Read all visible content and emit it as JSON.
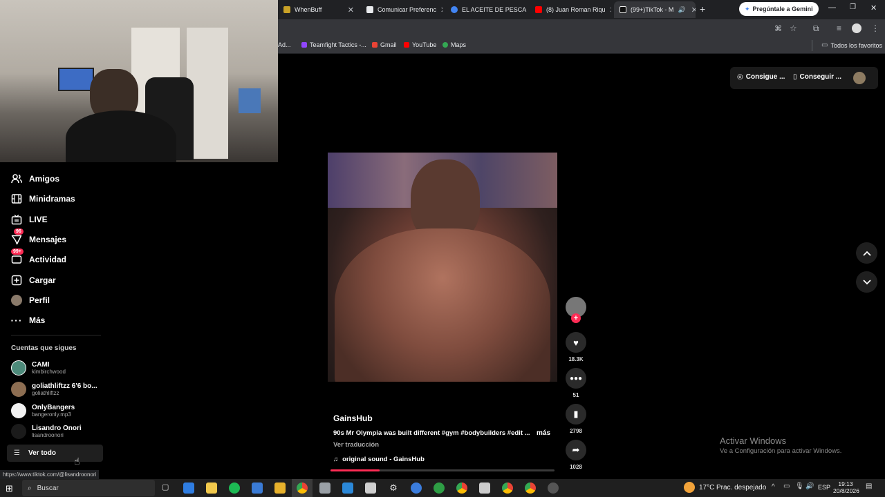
{
  "browser": {
    "tabs": [
      {
        "label": "WhenBuff",
        "favicon_color": "#c9a227"
      },
      {
        "label": "Comunicar Preferenc",
        "favicon_color": "#e8eaed"
      },
      {
        "label": "EL ACEITE DE PESCAI",
        "favicon_color": "#4285f4"
      },
      {
        "label": "(8) Juan Roman Riqu",
        "favicon_color": "#ff0000"
      },
      {
        "label": "(99+)TikTok - M",
        "favicon_color": "#000000"
      }
    ],
    "gemini_button": "Pregúntale a Gemini",
    "bookmarks": [
      {
        "label": "Ad...",
        "color": "#777777"
      },
      {
        "label": "Teamfight Tactics -...",
        "color": "#9146ff"
      },
      {
        "label": "Gmail",
        "color": "#ea4335"
      },
      {
        "label": "YouTube",
        "color": "#ff0000"
      },
      {
        "label": "Maps",
        "color": "#34a853"
      }
    ],
    "all_bookmarks": "Todos los favoritos"
  },
  "header": {
    "coins_button": "Consigue ...",
    "app_button": "Conseguir ..."
  },
  "sidebar": {
    "items": [
      {
        "label": "Amigos",
        "icon": "friends-icon"
      },
      {
        "label": "Minidramas",
        "icon": "film-icon"
      },
      {
        "label": "LIVE",
        "icon": "live-icon"
      },
      {
        "label": "Mensajes",
        "icon": "messages-icon",
        "badge": "96"
      },
      {
        "label": "Actividad",
        "icon": "activity-icon",
        "badge": "99+"
      },
      {
        "label": "Cargar",
        "icon": "upload-icon"
      },
      {
        "label": "Perfil",
        "icon": "profile-icon"
      },
      {
        "label": "Más",
        "icon": "more-icon"
      }
    ],
    "following_title": "Cuentas que sigues",
    "accounts": [
      {
        "name": "CAMI",
        "user": "kimbirchwood"
      },
      {
        "name": "goliathliftzz 6'6 bo...",
        "user": "goliathliftzz"
      },
      {
        "name": "OnlyBangers",
        "user": "bangeronly.mp3"
      },
      {
        "name": "Lisandro Onori",
        "user": "lisandroonori"
      }
    ],
    "see_all": "Ver todo"
  },
  "video": {
    "author": "GainsHub",
    "caption": "90s Mr Olympia was built different #gym #bodybuilders #edit ...",
    "more": "más",
    "translate": "Ver traducción",
    "sound": "original sound - GainsHub",
    "likes": "18.3K",
    "comments": "51",
    "saves": "2798",
    "shares": "1028",
    "progress": 0.22
  },
  "status_url": "https://www.tiktok.com/@lisandroonori",
  "watermark": {
    "title": "Activar Windows",
    "subtitle": "Ve a Configuración para activar Windows."
  },
  "taskbar": {
    "search": "Buscar",
    "weather": "17°C",
    "weather_desc": "Prac. despejado",
    "lang": "ESP",
    "time": "19:13",
    "date": "20/8/2026"
  }
}
